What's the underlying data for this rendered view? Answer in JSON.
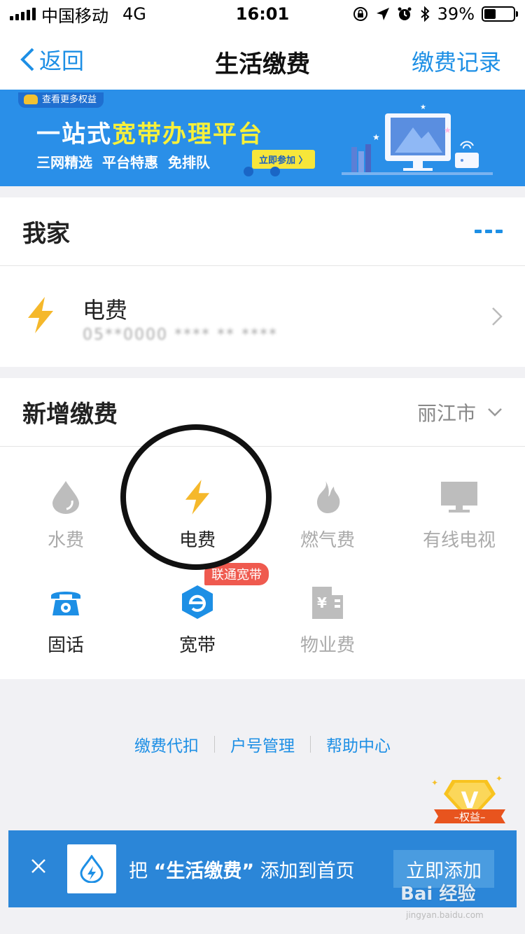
{
  "status_bar": {
    "carrier": "中国移动",
    "network": "4G",
    "time": "16:01",
    "battery": "39%",
    "battery_level": 0.39
  },
  "nav": {
    "back_label": "返回",
    "title": "生活缴费",
    "right_label": "缴费记录"
  },
  "banner": {
    "tag": "查看更多权益",
    "title_prefix": "一站式",
    "title_highlight": "宽带办理平台",
    "subtitle_items": [
      "三网精选",
      "平台特惠",
      "免排队"
    ],
    "cta": "立即参加 〉",
    "colors": {
      "background": "#2a8fe8",
      "highlight": "#f7f03a"
    }
  },
  "my_home": {
    "title": "我家",
    "bills": [
      {
        "name": "电费",
        "account": "05**0000 **** ** ****",
        "icon": "lightning-icon"
      }
    ]
  },
  "new_payment": {
    "title": "新增缴费",
    "city": "丽江市",
    "items": [
      {
        "label": "水费",
        "icon": "water-drop-icon"
      },
      {
        "label": "电费",
        "icon": "lightning-icon"
      },
      {
        "label": "燃气费",
        "icon": "flame-icon"
      },
      {
        "label": "有线电视",
        "icon": "tv-icon"
      },
      {
        "label": "固话",
        "icon": "telephone-icon"
      },
      {
        "label": "宽带",
        "icon": "broadband-icon",
        "badge": "联通宽带"
      },
      {
        "label": "物业费",
        "icon": "building-icon"
      }
    ]
  },
  "links": [
    "缴费代扣",
    "户号管理",
    "帮助中心"
  ],
  "perk_badge": {
    "label": "权益",
    "letter": "V"
  },
  "bottom_bar": {
    "text_before": "把 ",
    "text_app": "“生活缴费”",
    "text_after": " 添加到首页",
    "button": "立即添加"
  },
  "watermark": {
    "main": "Bai 经验",
    "sub": "jingyan.baidu.com"
  },
  "colors": {
    "accent": "#1d8fe5",
    "lightning": "#f5b82b",
    "disabled_icon": "#bdbdbd",
    "badge": "#ef5a4f"
  }
}
